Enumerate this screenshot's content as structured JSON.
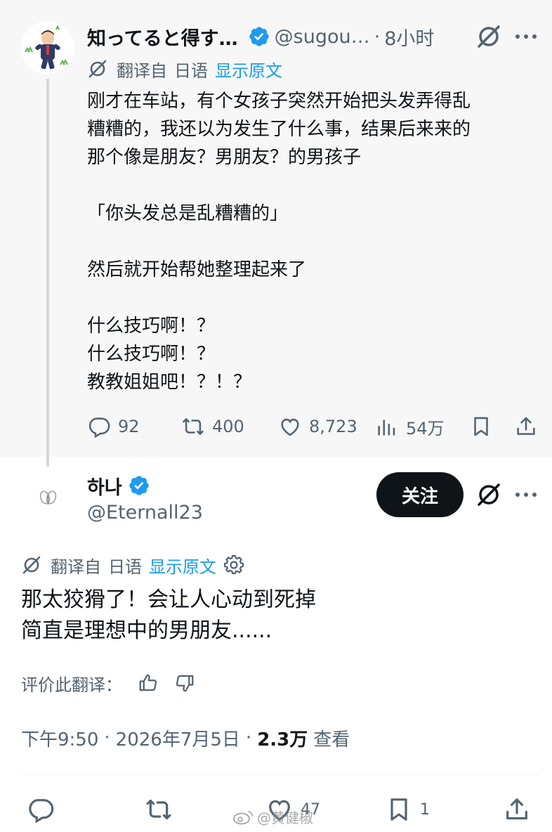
{
  "parent_tweet": {
    "author_name": "知ってると得す…",
    "handle": "@sugou…",
    "separator": "·",
    "time": "8小时",
    "translation": {
      "label": "翻译自",
      "language": "日语",
      "show_original": "显示原文"
    },
    "body_lines": [
      "刚才在车站，有个女孩子突然开始把头发弄得乱",
      "糟糟的，我还以为发生了什么事，结果后来来的",
      "那个像是朋友？男朋友？的男孩子",
      "",
      "「你头发总是乱糟糟的」",
      "",
      "然后就开始帮她整理起来了",
      "",
      "什么技巧啊！？",
      "什么技巧啊！？",
      "教教姐姐吧！？！？"
    ],
    "stats": {
      "replies": "92",
      "reposts": "400",
      "likes": "8,723",
      "views": "54万"
    }
  },
  "main_tweet": {
    "author_name": "하나",
    "handle": "@Eternall23",
    "follow_label": "关注",
    "translation": {
      "label": "翻译自",
      "language": "日语",
      "show_original": "显示原文"
    },
    "body_lines": [
      "那太狡猾了！会让人心动到死掉",
      "简直是理想中的男朋友......"
    ],
    "rate_label": "评价此翻译：",
    "time": "下午9:50",
    "separator": "·",
    "date": "2026年7月5日",
    "views_count": "2.3万",
    "views_label": "查看",
    "stats": {
      "likes": "47",
      "bookmarks": "1"
    }
  },
  "watermark": "@黄健椒",
  "colors": {
    "accent": "#1d9bf0",
    "text_primary": "#0f1419",
    "text_secondary": "#536471",
    "parent_background": "#f7f7f7",
    "follow_button": "#0f1419"
  },
  "icons": {
    "verified": "verified-badge-icon",
    "grok": "grok-icon",
    "more": "more-icon",
    "translate": "translate-icon",
    "settings": "gear-icon",
    "reply": "reply-icon",
    "repost": "repost-icon",
    "like": "heart-icon",
    "views": "views-icon",
    "bookmark": "bookmark-icon",
    "share": "share-icon",
    "thumb_up": "thumbs-up-icon",
    "thumb_down": "thumbs-down-icon"
  }
}
